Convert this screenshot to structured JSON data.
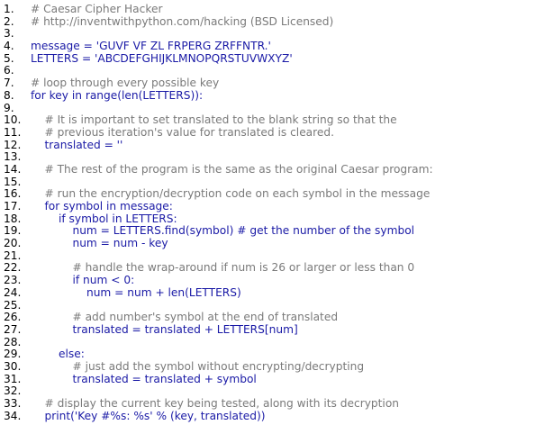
{
  "lines": [
    {
      "n": "1.",
      "text": "# Caesar Cipher Hacker",
      "comment": true
    },
    {
      "n": "2.",
      "text": "# http://inventwithpython.com/hacking (BSD Licensed)",
      "comment": true
    },
    {
      "n": "3.",
      "text": "",
      "comment": false
    },
    {
      "n": "4.",
      "text": "message = 'GUVF VF ZL FRPERG ZRFFNTR.'",
      "comment": false
    },
    {
      "n": "5.",
      "text": "LETTERS = 'ABCDEFGHIJKLMNOPQRSTUVWXYZ'",
      "comment": false
    },
    {
      "n": "6.",
      "text": "",
      "comment": false
    },
    {
      "n": "7.",
      "text": "# loop through every possible key",
      "comment": true
    },
    {
      "n": "8.",
      "text": "for key in range(len(LETTERS)):",
      "comment": false
    },
    {
      "n": "9.",
      "text": "",
      "comment": false
    },
    {
      "n": "10.",
      "text": "    # It is important to set translated to the blank string so that the",
      "comment": true
    },
    {
      "n": "11.",
      "text": "    # previous iteration's value for translated is cleared.",
      "comment": true
    },
    {
      "n": "12.",
      "text": "    translated = ''",
      "comment": false
    },
    {
      "n": "13.",
      "text": "",
      "comment": false
    },
    {
      "n": "14.",
      "text": "    # The rest of the program is the same as the original Caesar program:",
      "comment": true
    },
    {
      "n": "15.",
      "text": "",
      "comment": false
    },
    {
      "n": "16.",
      "text": "    # run the encryption/decryption code on each symbol in the message",
      "comment": true
    },
    {
      "n": "17.",
      "text": "    for symbol in message:",
      "comment": false
    },
    {
      "n": "18.",
      "text": "        if symbol in LETTERS:",
      "comment": false
    },
    {
      "n": "19.",
      "text": "            num = LETTERS.find(symbol) # get the number of the symbol",
      "comment": false
    },
    {
      "n": "20.",
      "text": "            num = num - key",
      "comment": false
    },
    {
      "n": "21.",
      "text": "",
      "comment": false
    },
    {
      "n": "22.",
      "text": "            # handle the wrap-around if num is 26 or larger or less than 0",
      "comment": true
    },
    {
      "n": "23.",
      "text": "            if num < 0:",
      "comment": false
    },
    {
      "n": "24.",
      "text": "                num = num + len(LETTERS)",
      "comment": false
    },
    {
      "n": "25.",
      "text": "",
      "comment": false
    },
    {
      "n": "26.",
      "text": "            # add number's symbol at the end of translated",
      "comment": true
    },
    {
      "n": "27.",
      "text": "            translated = translated + LETTERS[num]",
      "comment": false
    },
    {
      "n": "28.",
      "text": "",
      "comment": false
    },
    {
      "n": "29.",
      "text": "        else:",
      "comment": false
    },
    {
      "n": "30.",
      "text": "            # just add the symbol without encrypting/decrypting",
      "comment": true
    },
    {
      "n": "31.",
      "text": "            translated = translated + symbol",
      "comment": false
    },
    {
      "n": "32.",
      "text": "",
      "comment": false
    },
    {
      "n": "33.",
      "text": "    # display the current key being tested, along with its decryption",
      "comment": true
    },
    {
      "n": "34.",
      "text": "    print('Key #%s: %s' % (key, translated))",
      "comment": false
    }
  ],
  "colors": {
    "code": "#1a1aa6",
    "comment": "#7a7a7a",
    "line_number": "#000000",
    "background": "#ffffff"
  }
}
